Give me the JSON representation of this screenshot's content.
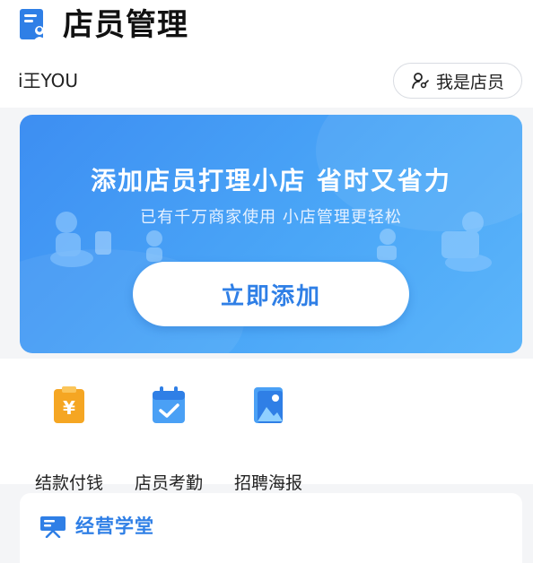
{
  "header": {
    "title": "店员管理",
    "icon": "staff-management-icon"
  },
  "user": {
    "name": "i王YOU",
    "staff_button_label": "我是店员",
    "staff_button_icon": "person-key-icon"
  },
  "banner": {
    "title": "添加店员打理小店  省时又省力",
    "subtitle": "已有千万商家使用 小店管理更轻松",
    "button_label": "立即添加"
  },
  "features": [
    {
      "label": "结款付钱",
      "icon": "yuan-clipboard-icon"
    },
    {
      "label": "店员考勤",
      "icon": "calendar-check-icon"
    },
    {
      "label": "招聘海报",
      "icon": "poster-image-icon"
    }
  ],
  "section": {
    "title": "经营学堂",
    "icon": "classroom-board-icon"
  },
  "colors": {
    "accent": "#2f7fe6",
    "banner_start": "#3d8ef2",
    "banner_end": "#5cb5fa",
    "feature_orange": "#f5a623",
    "background": "#f4f5f7"
  }
}
